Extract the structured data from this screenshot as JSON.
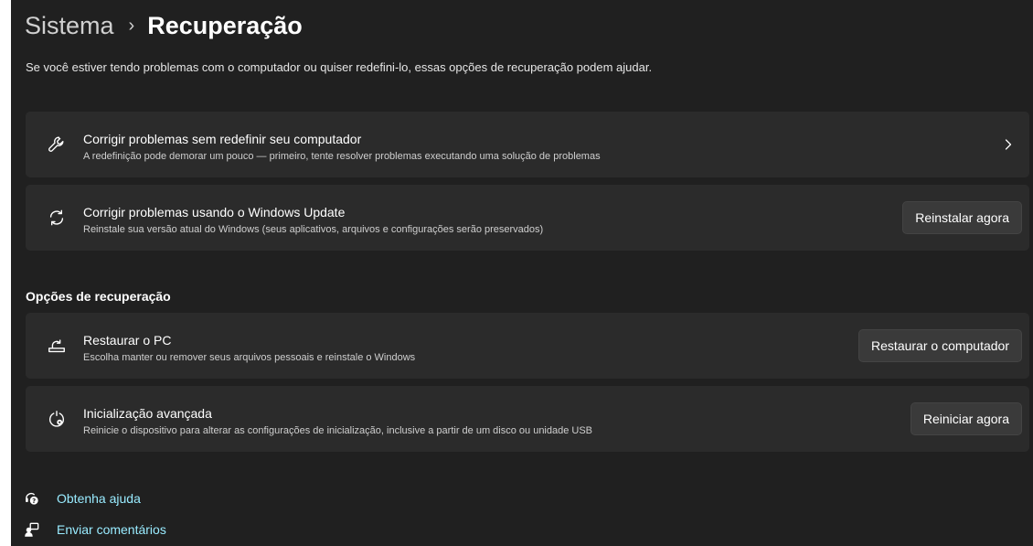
{
  "breadcrumb": {
    "parent": "Sistema",
    "separator": "›",
    "current": "Recuperação"
  },
  "description": "Se você estiver tendo problemas com o computador ou quiser redefini-lo, essas opções de recuperação podem ajudar.",
  "cards": [
    {
      "icon": "wrench-icon",
      "title": "Corrigir problemas sem redefinir seu computador",
      "subtitle": "A redefinição pode demorar um pouco — primeiro, tente resolver problemas executando uma solução de problemas"
    },
    {
      "icon": "sync-icon",
      "title": "Corrigir problemas usando o Windows Update",
      "subtitle": "Reinstale sua versão atual do Windows (seus aplicativos, arquivos e configurações serão preservados)",
      "button": "Reinstalar agora"
    }
  ],
  "recovery_section": {
    "title": "Opções de recuperação",
    "cards": [
      {
        "icon": "reset-pc-icon",
        "title": "Restaurar o PC",
        "subtitle": "Escolha manter ou remover seus arquivos pessoais e reinstale o Windows",
        "button": "Restaurar o computador"
      },
      {
        "icon": "advanced-startup-icon",
        "title": "Inicialização avançada",
        "subtitle": "Reinicie o dispositivo para alterar as configurações de inicialização, inclusive a partir de um disco ou unidade USB",
        "button": "Reiniciar agora"
      }
    ]
  },
  "footer_links": [
    {
      "icon": "help-icon",
      "label": "Obtenha ajuda"
    },
    {
      "icon": "feedback-icon",
      "label": "Enviar comentários"
    }
  ],
  "colors": {
    "background": "#202020",
    "card": "#2b2b2b",
    "button": "#3a3a3a",
    "link": "#99ebff"
  }
}
